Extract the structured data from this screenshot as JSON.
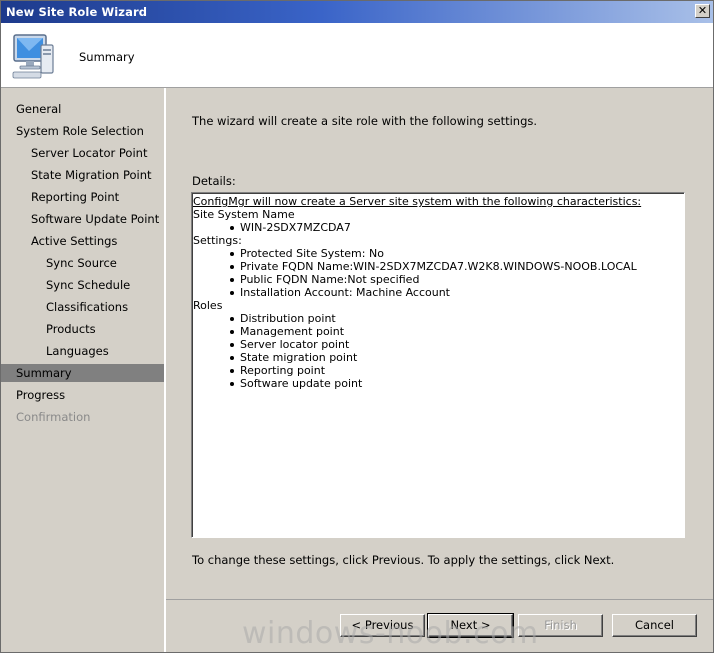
{
  "window": {
    "title": "New Site Role Wizard",
    "close_glyph": "✕"
  },
  "header": {
    "title": "Summary",
    "icon": "computer-monitor-icon"
  },
  "nav": {
    "items": [
      {
        "label": "General"
      },
      {
        "label": "System Role Selection"
      },
      {
        "label": "Server Locator Point"
      },
      {
        "label": "State Migration Point"
      },
      {
        "label": "Reporting Point"
      },
      {
        "label": "Software Update Point"
      },
      {
        "label": "Active Settings"
      },
      {
        "label": "Sync Source"
      },
      {
        "label": "Sync Schedule"
      },
      {
        "label": "Classifications"
      },
      {
        "label": "Products"
      },
      {
        "label": "Languages"
      },
      {
        "label": "Summary"
      },
      {
        "label": "Progress"
      },
      {
        "label": "Confirmation"
      }
    ]
  },
  "content": {
    "intro": "The wizard will create a site role with the following settings.",
    "details_label": "Details:",
    "details": {
      "heading": "ConfigMgr will now create a Server site system with the following characteristics:",
      "site_system_name_label": "Site System Name",
      "site_system_name": "WIN-2SDX7MZCDA7",
      "settings_label": "Settings:",
      "settings": [
        "Protected Site System: No",
        "Private FQDN Name:WIN-2SDX7MZCDA7.W2K8.WINDOWS-NOOB.LOCAL",
        "Public FQDN Name:Not specified",
        "Installation Account: Machine Account"
      ],
      "roles_label": "Roles",
      "roles": [
        "Distribution point",
        "Management point",
        "Server locator point",
        "State migration point",
        "Reporting point",
        "Software update point"
      ]
    },
    "footnote": "To change these settings, click Previous. To apply the settings, click Next."
  },
  "buttons": {
    "previous": "< Previous",
    "next": "Next >",
    "finish": "Finish",
    "cancel": "Cancel"
  },
  "watermark": "windows-noob.com"
}
